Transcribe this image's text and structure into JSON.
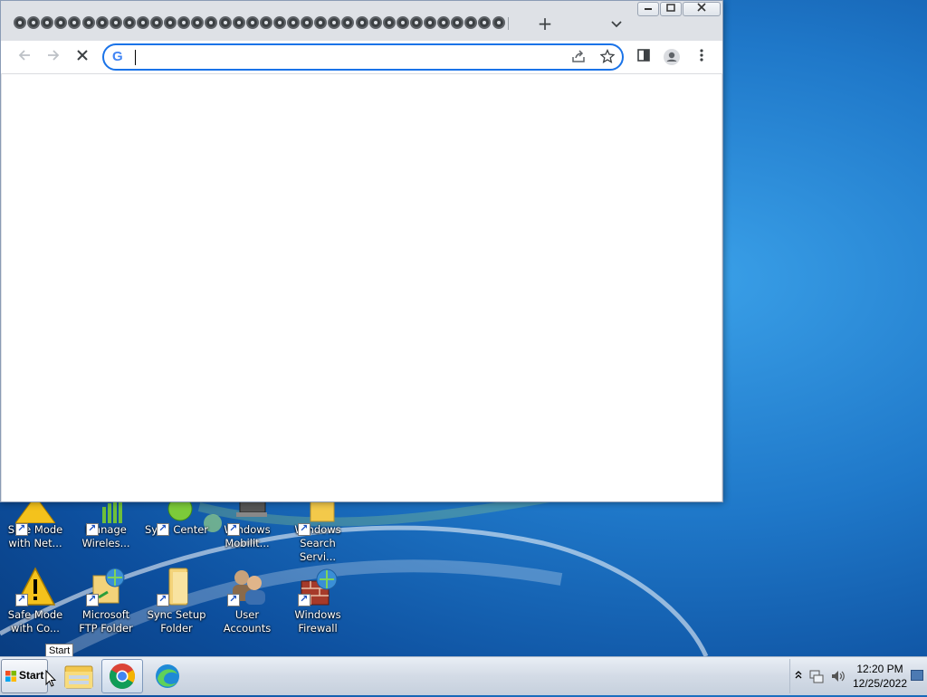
{
  "browser": {
    "tab_count": 36,
    "new_tab_label": "+",
    "tab_search_glyph": "⌄",
    "window_buttons": {
      "minimize": "▭",
      "maximize": "▣",
      "close": "✕"
    },
    "address_bar": {
      "value": "",
      "placeholder": ""
    },
    "reload_stop_glyph": "✕",
    "back_glyph": "←",
    "forward_glyph": "→"
  },
  "desktop": {
    "icons_row1": [
      {
        "label": "Safe Mode with Net..."
      },
      {
        "label": "Manage Wireles..."
      },
      {
        "label": "Sync Center"
      },
      {
        "label": "Windows Mobilit..."
      },
      {
        "label": "Windows Search Servi..."
      }
    ],
    "icons_row2": [
      {
        "label": "Safe Mode with Co..."
      },
      {
        "label": "Microsoft FTP Folder"
      },
      {
        "label": "Sync Setup Folder"
      },
      {
        "label": "User Accounts"
      },
      {
        "label": "Windows Firewall"
      }
    ]
  },
  "taskbar": {
    "start_label": "Start",
    "tooltip": "Start",
    "clock_time": "12:20 PM",
    "clock_date": "12/25/2022",
    "tray_expand_glyph": "⌃"
  }
}
